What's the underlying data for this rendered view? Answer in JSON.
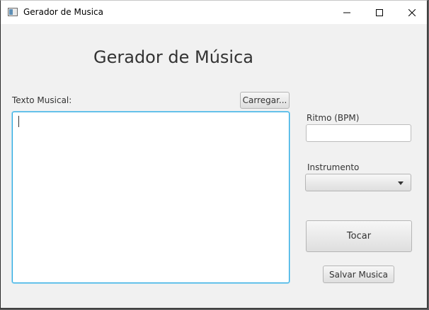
{
  "window": {
    "title": "Gerador de Musica"
  },
  "main": {
    "heading": "Gerador de Música",
    "texto_label": "Texto Musical:",
    "carregar_label": "Carregar...",
    "texto_value": "",
    "ritmo_label": "Ritmo (BPM)",
    "ritmo_value": "",
    "instrumento_label": "Instrumento",
    "instrumento_value": "",
    "tocar_label": "Tocar",
    "salvar_label": "Salvar Musica"
  },
  "colors": {
    "focus_border": "#29a8e0",
    "background": "#f1f1f1"
  },
  "icons": [
    "app-icon",
    "minimize-icon",
    "maximize-icon",
    "close-icon",
    "chevron-down-icon"
  ]
}
